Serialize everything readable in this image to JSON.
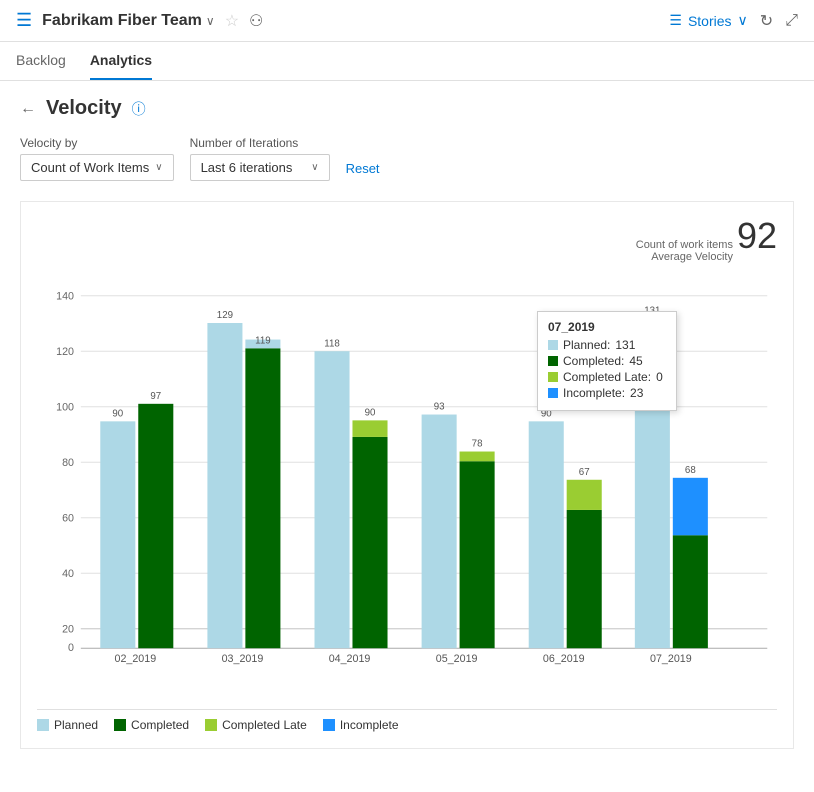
{
  "header": {
    "icon": "☰",
    "team_name": "Fabrikam Fiber Team",
    "chevron": "∨",
    "star": "☆",
    "team_members_icon": "👥",
    "stories_label": "Stories",
    "stories_chevron": "∨"
  },
  "nav": {
    "tabs": [
      {
        "id": "backlog",
        "label": "Backlog",
        "active": false
      },
      {
        "id": "analytics",
        "label": "Analytics",
        "active": true
      }
    ]
  },
  "page": {
    "title": "Velocity",
    "back_label": "←",
    "help_label": "ⓘ"
  },
  "filters": {
    "velocity_by_label": "Velocity by",
    "velocity_by_value": "Count of Work Items",
    "iterations_label": "Number of Iterations",
    "iterations_value": "Last 6 iterations",
    "reset_label": "Reset"
  },
  "chart": {
    "metric_label": "Count of work items",
    "avg_label": "Average Velocity",
    "avg_value": "92",
    "y_axis": [
      0,
      20,
      40,
      60,
      80,
      100,
      120,
      140
    ],
    "bars": [
      {
        "sprint": "02_2019",
        "planned": 90,
        "completed": 97,
        "completed_late": 0,
        "incomplete": 0
      },
      {
        "sprint": "03_2019",
        "planned": 129,
        "completed": 119,
        "completed_late": 0,
        "incomplete": 0
      },
      {
        "sprint": "04_2019",
        "planned": 118,
        "completed": 84,
        "completed_late": 90,
        "incomplete": 0
      },
      {
        "sprint": "05_2019",
        "planned": 93,
        "completed": 74,
        "completed_late": 78,
        "incomplete": 0
      },
      {
        "sprint": "06_2019",
        "planned": 90,
        "completed": 55,
        "completed_late": 67,
        "incomplete": 0
      },
      {
        "sprint": "07_2019",
        "planned": 131,
        "completed": 45,
        "completed_late": 0,
        "incomplete": 23
      }
    ],
    "tooltip": {
      "sprint": "07_2019",
      "planned_label": "Planned:",
      "planned_value": "131",
      "completed_label": "Completed:",
      "completed_value": "45",
      "completed_late_label": "Completed Late:",
      "completed_late_value": "0",
      "incomplete_label": "Incomplete:",
      "incomplete_value": "23"
    },
    "legend": [
      {
        "id": "planned",
        "label": "Planned",
        "color": "#add8e6"
      },
      {
        "id": "completed",
        "label": "Completed",
        "color": "#006400"
      },
      {
        "id": "completed_late",
        "label": "Completed Late",
        "color": "#9acd32"
      },
      {
        "id": "incomplete",
        "label": "Incomplete",
        "color": "#1e90ff"
      }
    ]
  }
}
